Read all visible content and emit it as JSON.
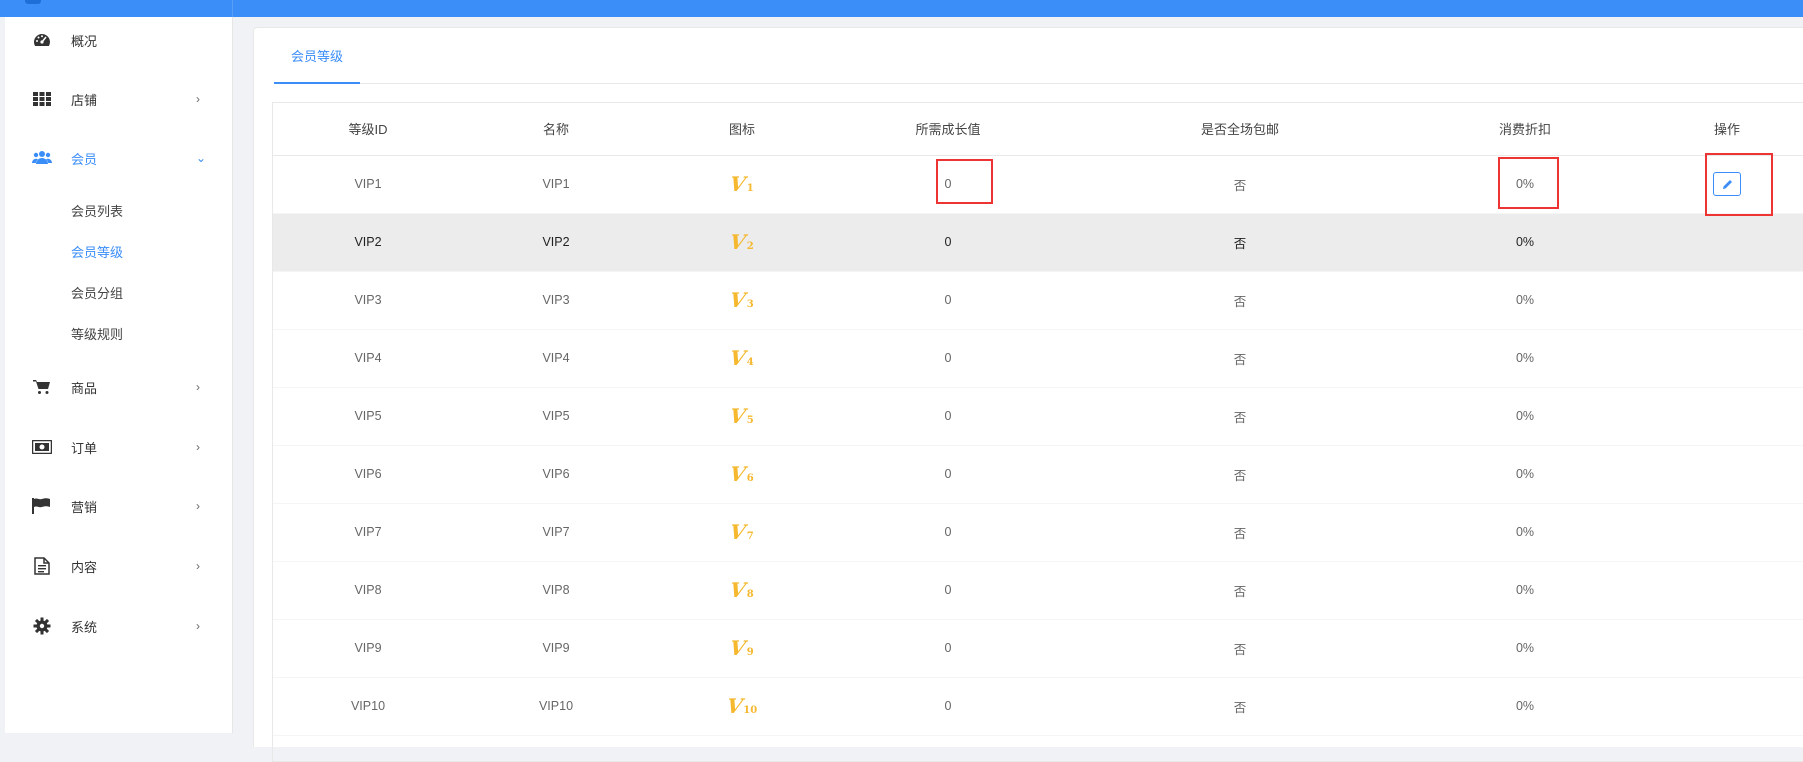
{
  "sidebar": {
    "items": [
      {
        "label": "概况",
        "icon": "dashboard-icon"
      },
      {
        "label": "店铺",
        "icon": "grid-icon"
      },
      {
        "label": "会员",
        "icon": "users-icon"
      },
      {
        "label": "商品",
        "icon": "cart-icon"
      },
      {
        "label": "订单",
        "icon": "money-icon"
      },
      {
        "label": "营销",
        "icon": "flag-icon"
      },
      {
        "label": "内容",
        "icon": "document-icon"
      },
      {
        "label": "系统",
        "icon": "gear-icon"
      }
    ],
    "member_sub": [
      "会员列表",
      "会员等级",
      "会员分组",
      "等级规则"
    ]
  },
  "tabs": {
    "active": "会员等级"
  },
  "table": {
    "headers": [
      "等级ID",
      "名称",
      "图标",
      "所需成长值",
      "是否全场包邮",
      "消费折扣",
      "操作"
    ],
    "rows": [
      {
        "id": "VIP1",
        "name": "VIP1",
        "level": "1",
        "growth": "0",
        "free_ship": "否",
        "discount": "0%"
      },
      {
        "id": "VIP2",
        "name": "VIP2",
        "level": "2",
        "growth": "0",
        "free_ship": "否",
        "discount": "0%"
      },
      {
        "id": "VIP3",
        "name": "VIP3",
        "level": "3",
        "growth": "0",
        "free_ship": "否",
        "discount": "0%"
      },
      {
        "id": "VIP4",
        "name": "VIP4",
        "level": "4",
        "growth": "0",
        "free_ship": "否",
        "discount": "0%"
      },
      {
        "id": "VIP5",
        "name": "VIP5",
        "level": "5",
        "growth": "0",
        "free_ship": "否",
        "discount": "0%"
      },
      {
        "id": "VIP6",
        "name": "VIP6",
        "level": "6",
        "growth": "0",
        "free_ship": "否",
        "discount": "0%"
      },
      {
        "id": "VIP7",
        "name": "VIP7",
        "level": "7",
        "growth": "0",
        "free_ship": "否",
        "discount": "0%"
      },
      {
        "id": "VIP8",
        "name": "VIP8",
        "level": "8",
        "growth": "0",
        "free_ship": "否",
        "discount": "0%"
      },
      {
        "id": "VIP9",
        "name": "VIP9",
        "level": "9",
        "growth": "0",
        "free_ship": "否",
        "discount": "0%"
      },
      {
        "id": "VIP10",
        "name": "VIP10",
        "level": "10",
        "growth": "0",
        "free_ship": "否",
        "discount": "0%"
      }
    ]
  },
  "colors": {
    "primary": "#3b8ef8",
    "vip_gold": "#f5b82e",
    "highlight_red": "#e33333",
    "row_hover": "#ececec"
  }
}
